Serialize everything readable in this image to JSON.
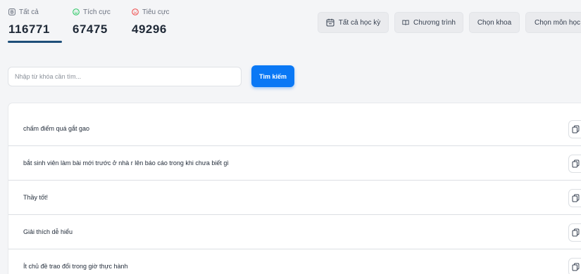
{
  "stats": [
    {
      "label": "Tất cả",
      "value": "116771",
      "icon": "all-icon",
      "active": true
    },
    {
      "label": "Tích cực",
      "value": "67475",
      "icon": "smile-icon",
      "color": "#22c55e"
    },
    {
      "label": "Tiêu cực",
      "value": "49296",
      "icon": "frown-icon",
      "color": "#ef4444"
    }
  ],
  "filters": [
    {
      "label": "Tất cả học kỳ",
      "icon": "calendar-icon"
    },
    {
      "label": "Chương trình",
      "icon": "book-icon"
    },
    {
      "label": "Chọn khoa"
    },
    {
      "label": "Chọn môn học"
    }
  ],
  "search": {
    "placeholder": "Nhập từ khóa cần tìm...",
    "button_label": "Tìm kiếm"
  },
  "comments": [
    "chấm điểm quá gắt gao",
    "bắt sinh viên làm bài mới trước ở nhà r lên báo cáo trong khi chưa biết gì",
    "Thầy tốt!",
    "Giải thích dễ hiểu",
    "Ít chủ đề trao đổi trong giờ thực hành"
  ],
  "colors": {
    "accent": "#0a78f5",
    "active_underline": "#1e4e79"
  }
}
